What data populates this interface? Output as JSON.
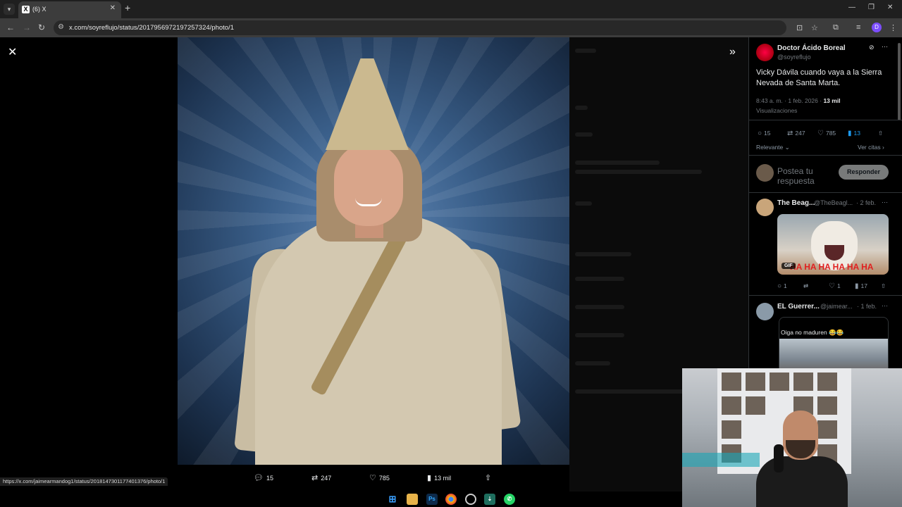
{
  "browser": {
    "tab_title": "(6) X",
    "tab_favicon": "X",
    "url": "x.com/soyreflujo/status/2017956972197257324/photo/1",
    "status_url": "https://x.com/jaimearmandog1/status/2018147301177401376/photo/1",
    "profile_initial": "D"
  },
  "viewer": {
    "actions": {
      "replies": "15",
      "reposts": "247",
      "likes": "785",
      "views": "13 mil"
    }
  },
  "post": {
    "author_name": "Doctor Ácido Boreal",
    "author_handle": "@soyreflujo",
    "text": "Vicky Dávila cuando vaya a la Sierra Nevada de Santa Marta.",
    "time": "8:43 a. m. · 1 feb. 2026 · ",
    "views_count": "13 mil",
    "views_label": "Visualizaciones",
    "stats": {
      "replies": "15",
      "reposts": "247",
      "likes": "785",
      "bookmarks": "13"
    },
    "sort_label": "Relevante",
    "quotes_link": "Ver citas",
    "reply_placeholder": "Postea tu respuesta",
    "reply_button": "Responder"
  },
  "replies": [
    {
      "name": "The Beag...",
      "handle": "@TheBeagl...",
      "date": "· 2 feb.",
      "gif_text": "HA HA HA HA HA HA",
      "gif_badge": "GIF",
      "stats": {
        "replies": "1",
        "likes": "1",
        "views": "17"
      }
    },
    {
      "name": "EL Guerrer...",
      "handle": "@jaimear...",
      "date": "· 1 feb.",
      "quote_text": "Oiga no maduren 😂😂"
    }
  ],
  "colors": {
    "accent": "#1d9bf0",
    "background": "#000000",
    "border": "#2f3336"
  }
}
